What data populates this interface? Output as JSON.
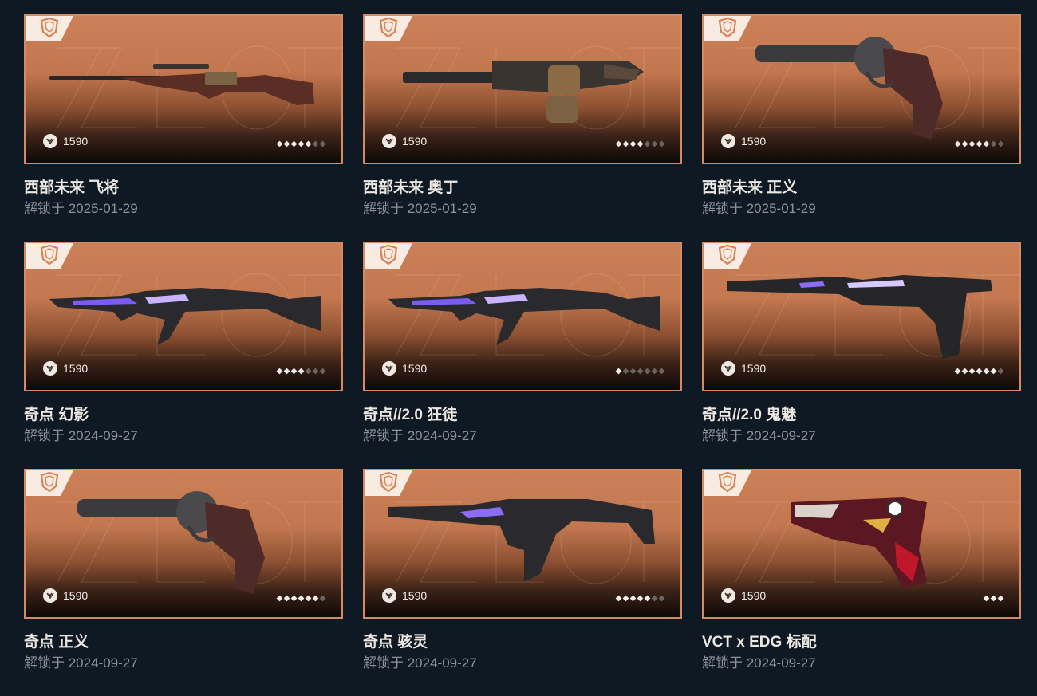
{
  "date_prefix": "解锁于",
  "items": [
    {
      "name": "西部未来 飞将",
      "date": "解锁于 2025-01-29",
      "price": "1590",
      "level": 5,
      "max_level": 7,
      "weapon": "rifle-icon"
    },
    {
      "name": "西部未来 奥丁",
      "date": "解锁于 2025-01-29",
      "price": "1590",
      "level": 4,
      "max_level": 7,
      "weapon": "machine-gun-icon"
    },
    {
      "name": "西部未来 正义",
      "date": "解锁于 2025-01-29",
      "price": "1590",
      "level": 5,
      "max_level": 7,
      "weapon": "revolver-icon"
    },
    {
      "name": "奇点 幻影",
      "date": "解锁于 2024-09-27",
      "price": "1590",
      "level": 4,
      "max_level": 7,
      "weapon": "assault-rifle-icon"
    },
    {
      "name": "奇点//2.0 狂徒",
      "date": "解锁于 2024-09-27",
      "price": "1590",
      "level": 1,
      "max_level": 7,
      "weapon": "assault-rifle-icon"
    },
    {
      "name": "奇点//2.0 鬼魅",
      "date": "解锁于 2024-09-27",
      "price": "1590",
      "level": 6,
      "max_level": 7,
      "weapon": "pistol-icon"
    },
    {
      "name": "奇点 正义",
      "date": "解锁于 2024-09-27",
      "price": "1590",
      "level": 6,
      "max_level": 7,
      "weapon": "revolver-icon"
    },
    {
      "name": "奇点 骇灵",
      "date": "解锁于 2024-09-27",
      "price": "1590",
      "level": 5,
      "max_level": 7,
      "weapon": "smg-icon"
    },
    {
      "name": "VCT x EDG 标配",
      "date": "解锁于 2024-09-27",
      "price": "1590",
      "level": 3,
      "max_level": 3,
      "weapon": "pistol-icon"
    }
  ],
  "colors": {
    "background": "#0f1923",
    "card_border": "#d58a63",
    "accent_orange": "#cc8058"
  },
  "icons": {
    "tier": "tier-badge-icon",
    "currency": "valorant-points-icon",
    "level": "level-diamond-icon"
  }
}
